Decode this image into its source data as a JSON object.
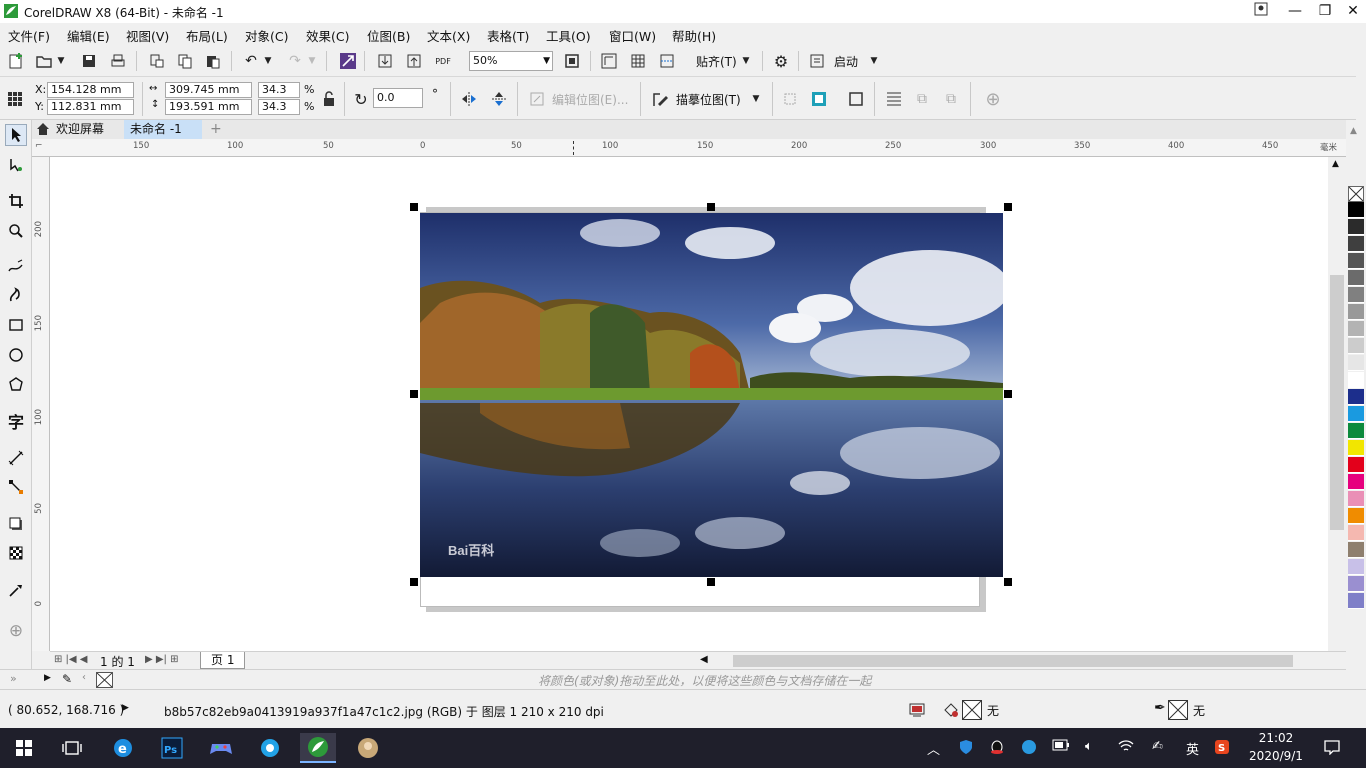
{
  "window": {
    "title": "CorelDRAW X8 (64-Bit) - 未命名 -1",
    "min_label": "—",
    "restore_label": "❐",
    "close_label": "✕"
  },
  "menu": [
    "文件(F)",
    "编辑(E)",
    "视图(V)",
    "布局(L)",
    "对象(C)",
    "效果(C)",
    "位图(B)",
    "文本(X)",
    "表格(T)",
    "工具(O)",
    "窗口(W)",
    "帮助(H)"
  ],
  "toolbar": {
    "zoom_value": "50%",
    "snap_label": "贴齐(T)",
    "launch_label": "启动"
  },
  "propertybar": {
    "x_label": "X:",
    "x_value": "154.128 mm",
    "y_label": "Y:",
    "y_value": "112.831 mm",
    "w_value": "309.745 mm",
    "h_value": "193.591 mm",
    "scale_w": "34.3",
    "scale_h": "34.3",
    "percent": "%",
    "rotation_value": "0.0",
    "degree": "°",
    "edit_bitmap_label": "编辑位图(E)...",
    "trace_bitmap_label": "描摹位图(T)"
  },
  "tabs": [
    {
      "label": "欢迎屏幕",
      "active": false
    },
    {
      "label": "未命名 -1",
      "active": true
    }
  ],
  "ruler": {
    "h_ticks": [
      "150",
      "100",
      "50",
      "0",
      "50",
      "100",
      "150",
      "200",
      "250",
      "300",
      "350",
      "400",
      "450"
    ],
    "v_ticks": [
      "200",
      "150",
      "100",
      "50",
      "0"
    ],
    "unit": "毫米"
  },
  "page_nav": {
    "page_info": "1 的 1",
    "page_tab": "页 1"
  },
  "doc_palette_hint": "将颜色(或对象)拖动至此处，以便将这些颜色与文档存储在一起",
  "statusbar": {
    "coords": "( 80.652, 168.716 )",
    "info": "b8b57c82eb9a0413919a937f1a47c1c2.jpg (RGB) 于 图层 1 210 x 210 dpi",
    "fill_none": "无",
    "outline_none": "无"
  },
  "taskbar": {
    "time": "21:02",
    "date": "2020/9/1",
    "ime": "英"
  },
  "photo_watermark": "Bai百科",
  "colors": {
    "accent_green": "#2d9a3a",
    "tab_active": "#c9e0f7",
    "taskbar": "#1f1f2b"
  },
  "palette": [
    "#000000",
    "#2b2b2b",
    "#3f3f3f",
    "#555555",
    "#6b6b6b",
    "#808080",
    "#999999",
    "#b3b3b3",
    "#cccccc",
    "#e6e6e6",
    "#ffffff",
    "#1c2e8c",
    "#1a9ae0",
    "#0c8a3c",
    "#f2e600",
    "#e3001b",
    "#e6007e",
    "#ea8fb6",
    "#f08c00",
    "#f5b8b0",
    "#8e7f6e",
    "#c8c0e8",
    "#9a8fd0",
    "#7f7fc8"
  ]
}
